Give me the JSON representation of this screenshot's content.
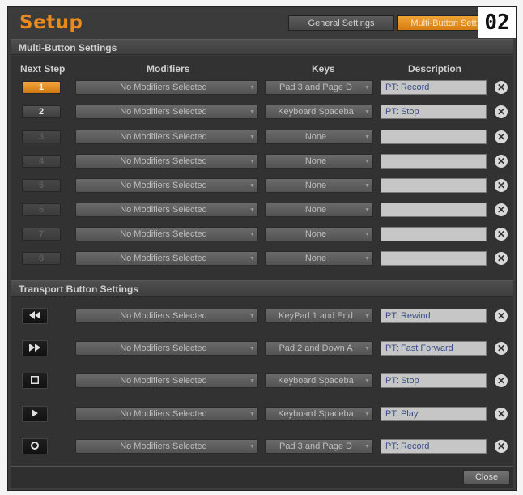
{
  "window": {
    "title": "Setup",
    "badge": "02"
  },
  "tabs": [
    {
      "label": "General Settings",
      "active": false
    },
    {
      "label": "Multi-Button Sett",
      "active": true
    }
  ],
  "multi_button": {
    "section_label": "Multi-Button Settings",
    "columns": {
      "step": "Next Step",
      "modifiers": "Modifiers",
      "keys": "Keys",
      "description": "Description"
    },
    "rows": [
      {
        "step": "1",
        "state": "active",
        "modifier": "No Modifiers Selected",
        "key": "Pad 3 and Page D",
        "description": "PT: Record"
      },
      {
        "step": "2",
        "state": "normal",
        "modifier": "No Modifiers Selected",
        "key": "Keyboard Spaceba",
        "description": "PT: Stop"
      },
      {
        "step": "3",
        "state": "dim",
        "modifier": "No Modifiers Selected",
        "key": "None",
        "description": ""
      },
      {
        "step": "4",
        "state": "dim",
        "modifier": "No Modifiers Selected",
        "key": "None",
        "description": ""
      },
      {
        "step": "5",
        "state": "dim",
        "modifier": "No Modifiers Selected",
        "key": "None",
        "description": ""
      },
      {
        "step": "6",
        "state": "dim",
        "modifier": "No Modifiers Selected",
        "key": "None",
        "description": ""
      },
      {
        "step": "7",
        "state": "dim",
        "modifier": "No Modifiers Selected",
        "key": "None",
        "description": ""
      },
      {
        "step": "8",
        "state": "dim",
        "modifier": "No Modifiers Selected",
        "key": "None",
        "description": ""
      }
    ]
  },
  "transport": {
    "section_label": "Transport Button Settings",
    "rows": [
      {
        "icon": "rewind-icon",
        "modifier": "No Modifiers Selected",
        "key": "KeyPad 1 and End",
        "description": "PT: Rewind"
      },
      {
        "icon": "fast-forward-icon",
        "modifier": "No Modifiers Selected",
        "key": "Pad 2 and Down A",
        "description": "PT: Fast Forward"
      },
      {
        "icon": "stop-icon",
        "modifier": "No Modifiers Selected",
        "key": "Keyboard Spaceba",
        "description": "PT: Stop"
      },
      {
        "icon": "play-icon",
        "modifier": "No Modifiers Selected",
        "key": "Keyboard Spaceba",
        "description": "PT: Play"
      },
      {
        "icon": "record-icon",
        "modifier": "No Modifiers Selected",
        "key": "Pad 3 and Page D",
        "description": "PT: Record"
      }
    ]
  },
  "footer": {
    "close_label": "Close"
  },
  "colors": {
    "accent": "#e88a1c",
    "background": "#3b3b3b",
    "field": "#c6c6c6"
  },
  "icons": {
    "clear": "clear-x-icon",
    "caret": "dropdown-caret-icon"
  }
}
